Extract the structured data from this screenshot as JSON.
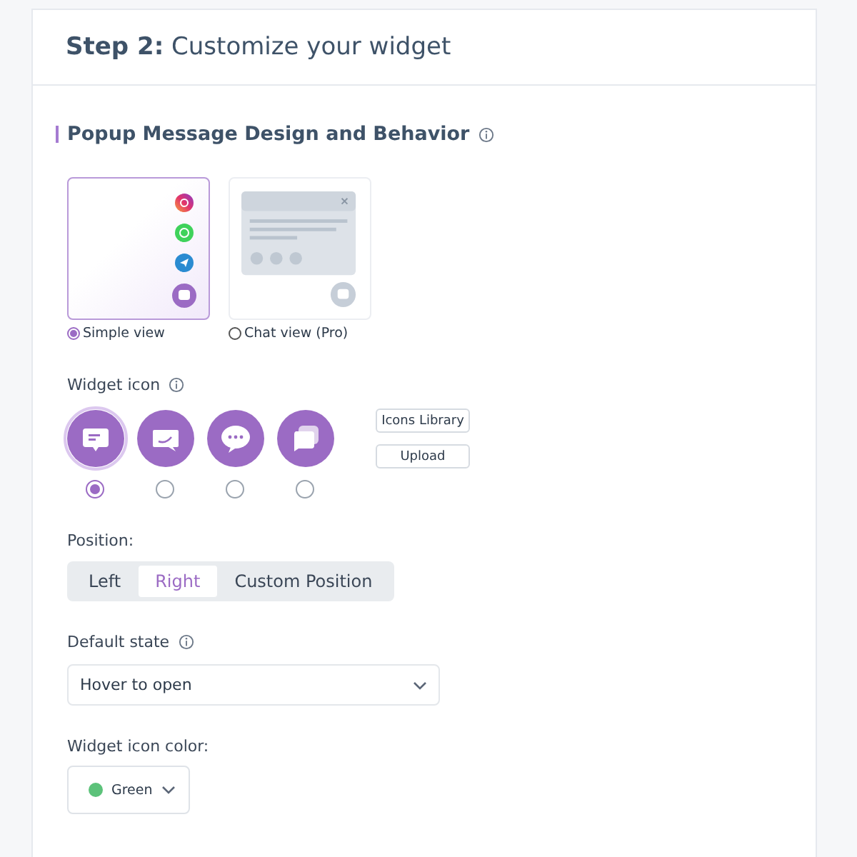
{
  "header": {
    "title": "**Step 2:** Customize your widget"
  },
  "section": {
    "title": "Popup Message Design and Behavior"
  },
  "views": [
    {
      "label": "Simple view",
      "kind": "simple",
      "selected": true
    },
    {
      "label": "Chat view (Pro)",
      "kind": "chat",
      "selected": false
    }
  ],
  "widget_icon": {
    "label": "Widget icon",
    "options": [
      {
        "kind": "note",
        "selected": true
      },
      {
        "kind": "arrow",
        "selected": false
      },
      {
        "kind": "dots",
        "selected": false
      },
      {
        "kind": "stack",
        "selected": false
      }
    ],
    "buttons": [
      "Icons Library",
      "Upload"
    ]
  },
  "position": {
    "label": "Position:",
    "options": [
      {
        "label": "Left",
        "selected": false
      },
      {
        "label": "Right",
        "selected": true
      },
      {
        "label": "Custom Position",
        "selected": false
      }
    ]
  },
  "default_state": {
    "label": "Default state",
    "value": "Hover to open"
  },
  "icon_color": {
    "label": "Widget icon color:",
    "value": "Green",
    "color": "#5cc27a"
  }
}
